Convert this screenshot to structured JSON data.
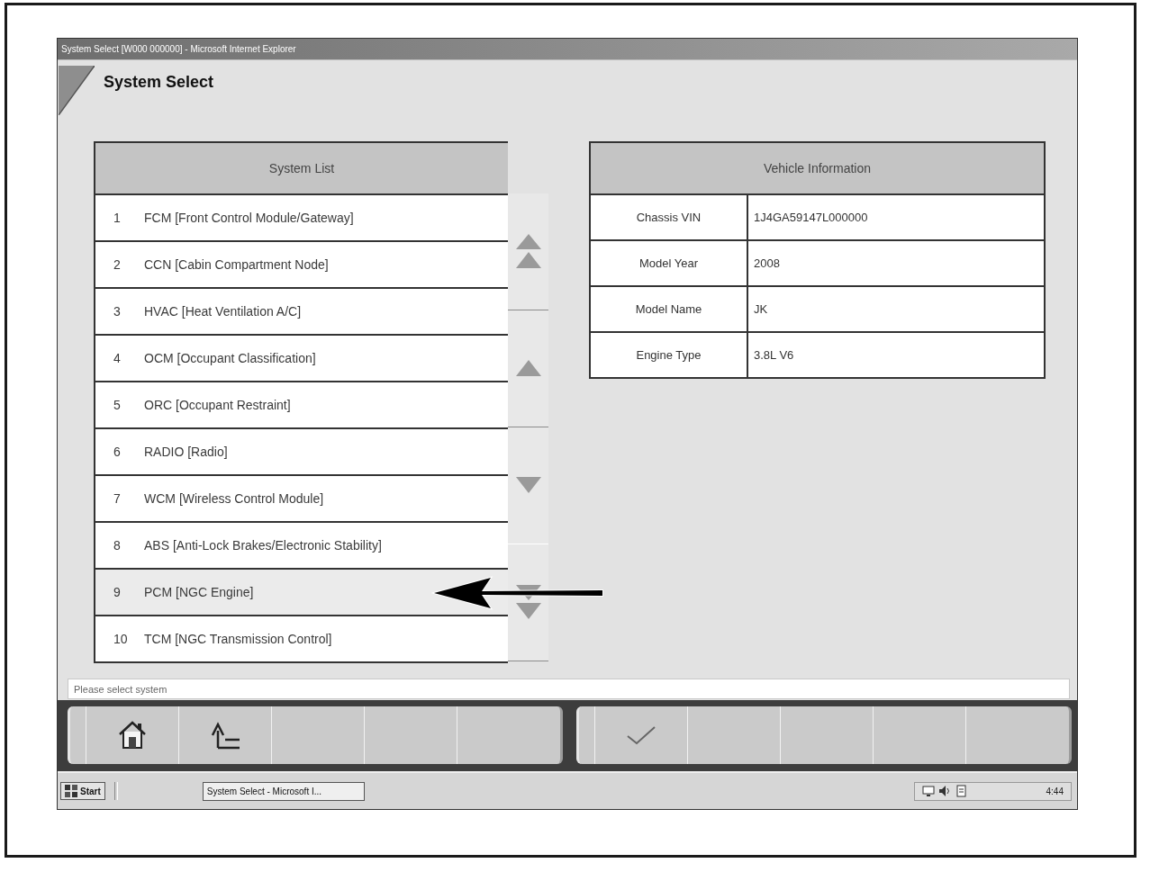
{
  "window": {
    "title": "System Select [W000 000000] - Microsoft Internet Explorer"
  },
  "page": {
    "heading": "System Select"
  },
  "system_list": {
    "heading": "System List",
    "rows": [
      {
        "number": "1",
        "name": "FCM [Front Control Module/Gateway]",
        "selected": false,
        "pointed": false
      },
      {
        "number": "2",
        "name": "CCN [Cabin Compartment Node]",
        "selected": false,
        "pointed": false
      },
      {
        "number": "3",
        "name": "HVAC [Heat Ventilation A/C]",
        "selected": false,
        "pointed": false
      },
      {
        "number": "4",
        "name": "OCM [Occupant Classification]",
        "selected": false,
        "pointed": false
      },
      {
        "number": "5",
        "name": "ORC [Occupant Restraint]",
        "selected": false,
        "pointed": false
      },
      {
        "number": "6",
        "name": "RADIO [Radio]",
        "selected": false,
        "pointed": false
      },
      {
        "number": "7",
        "name": "WCM [Wireless Control Module]",
        "selected": false,
        "pointed": false
      },
      {
        "number": "8",
        "name": "ABS [Anti-Lock Brakes/Electronic Stability]",
        "selected": false,
        "pointed": false
      },
      {
        "number": "9",
        "name": "PCM [NGC Engine]",
        "selected": true,
        "pointed": true
      },
      {
        "number": "10",
        "name": "TCM [NGC Transmission Control]",
        "selected": false,
        "pointed": false
      }
    ]
  },
  "scroll_buttons": [
    {
      "kind": "page_up"
    },
    {
      "kind": "up"
    },
    {
      "kind": "down"
    },
    {
      "kind": "page_down"
    }
  ],
  "vehicle_info": {
    "heading": "Vehicle Information",
    "rows": [
      {
        "label": "Chassis VIN",
        "value": "1J4GA59147L000000"
      },
      {
        "label": "Model Year",
        "value": "2008"
      },
      {
        "label": "Model Name",
        "value": "JK"
      },
      {
        "label": "Engine Type",
        "value": "3.8L V6"
      }
    ]
  },
  "status": {
    "message": "Please select system"
  },
  "toolbar": {
    "left": [
      {
        "kind": "home"
      },
      {
        "kind": "exit"
      },
      {
        "kind": "empty"
      },
      {
        "kind": "empty"
      },
      {
        "kind": "empty"
      }
    ],
    "right": [
      {
        "kind": "confirm"
      },
      {
        "kind": "empty"
      },
      {
        "kind": "empty"
      },
      {
        "kind": "empty"
      },
      {
        "kind": "empty"
      }
    ]
  },
  "taskbar": {
    "start": "Start",
    "tasks": [
      {
        "label": "System Select - Microsoft I..."
      }
    ],
    "clock": "4:44"
  }
}
